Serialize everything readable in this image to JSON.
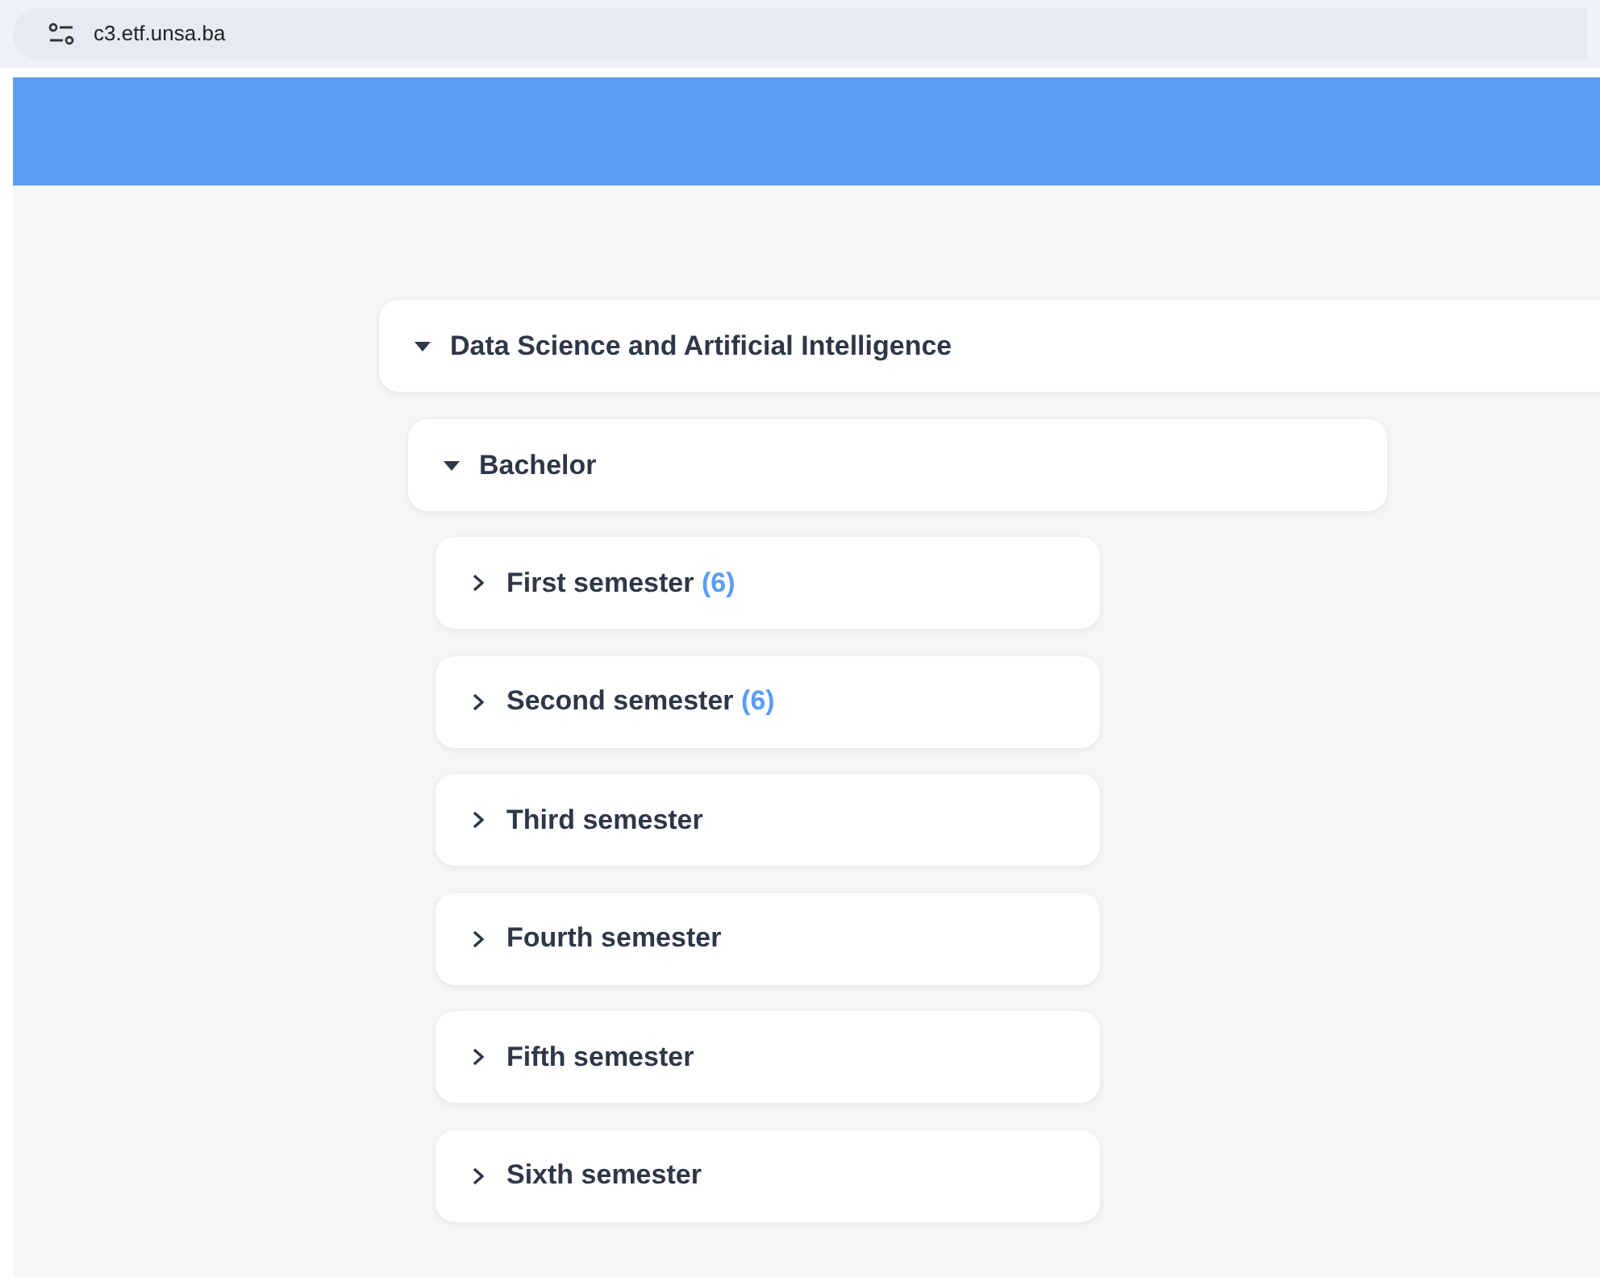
{
  "address_bar": {
    "url": "c3.etf.unsa.ba"
  },
  "program": {
    "title": "Data Science and Artificial Intelligence",
    "expanded": true,
    "level": {
      "title": "Bachelor",
      "expanded": true,
      "semesters": [
        {
          "title": "First semester",
          "count": "(6)",
          "expanded": false
        },
        {
          "title": "Second semester",
          "count": "(6)",
          "expanded": false
        },
        {
          "title": "Third semester",
          "expanded": false
        },
        {
          "title": "Fourth semester",
          "expanded": false
        },
        {
          "title": "Fifth semester",
          "expanded": false
        },
        {
          "title": "Sixth semester",
          "expanded": false
        }
      ]
    }
  }
}
